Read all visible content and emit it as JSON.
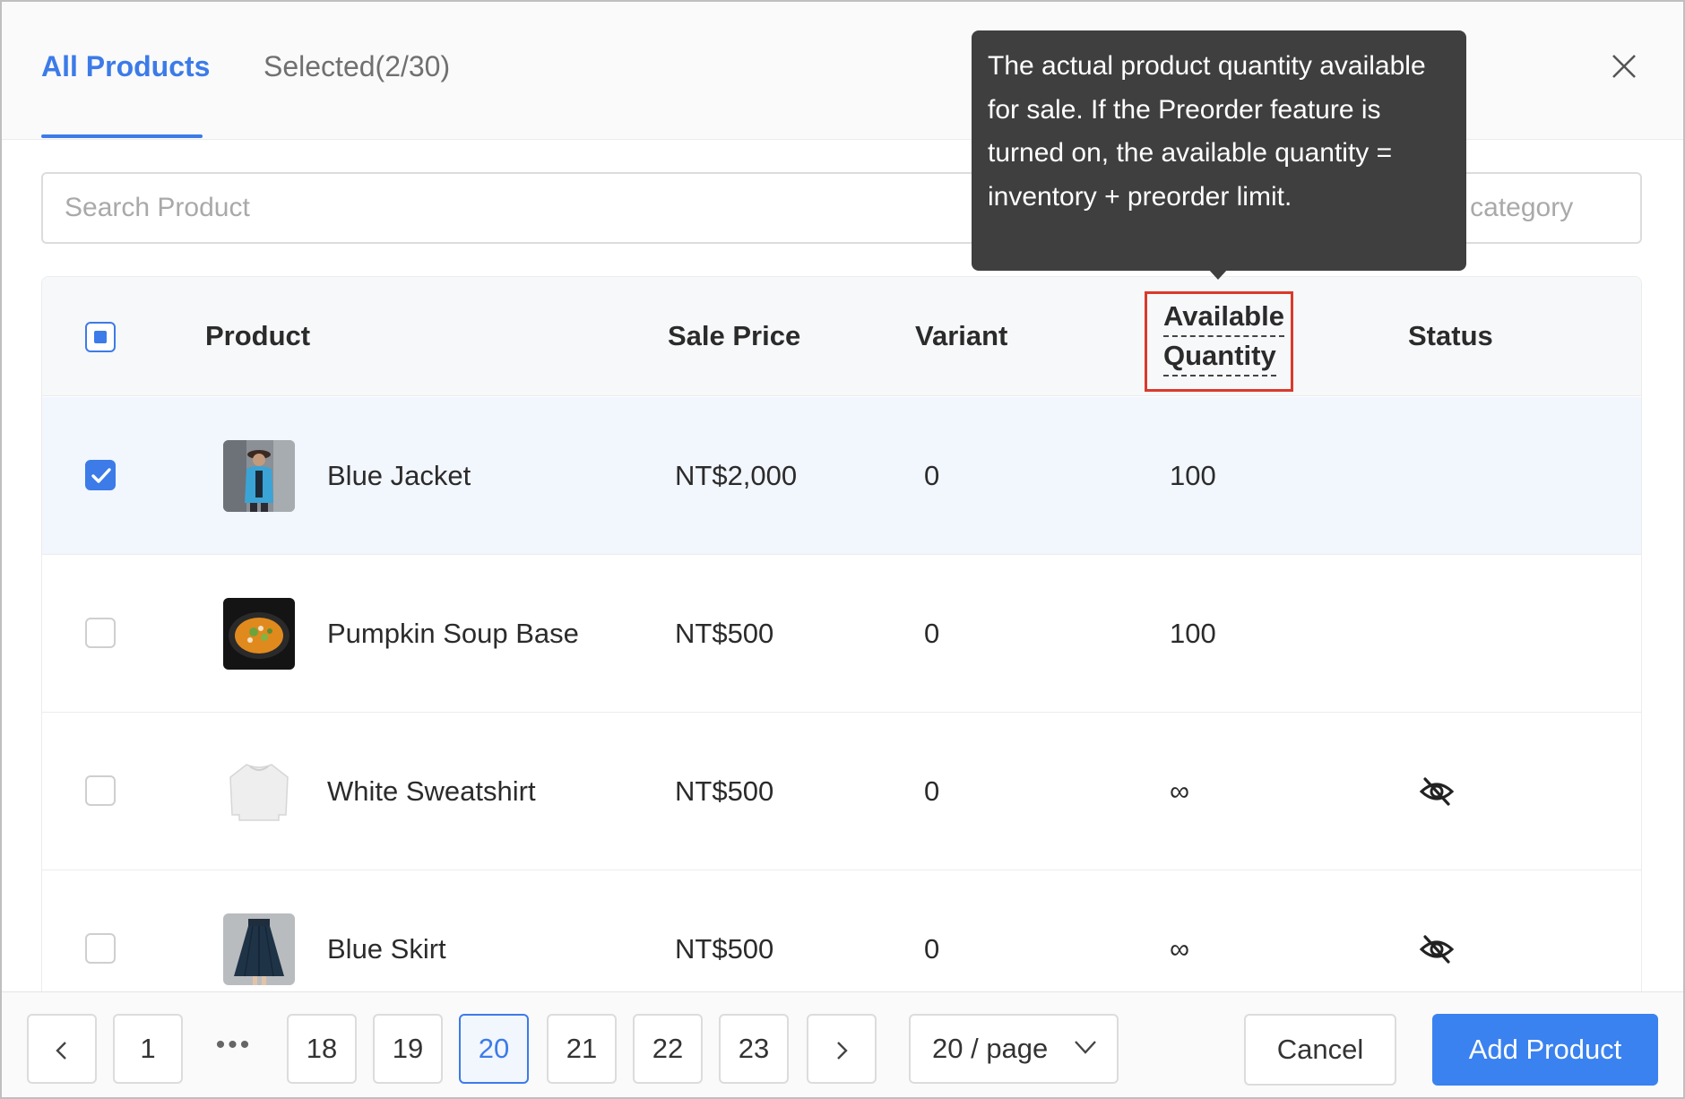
{
  "tabs": {
    "all_label": "All Products",
    "selected_label": "Selected(2/30)"
  },
  "search": {
    "placeholder": "Search Product",
    "category_placeholder": "Choose product category"
  },
  "table": {
    "headers": {
      "product": "Product",
      "sale_price": "Sale Price",
      "variant": "Variant",
      "available_line1": "Available",
      "available_line2": "Quantity",
      "status": "Status"
    },
    "rows": [
      {
        "name": "Blue Jacket",
        "price": "NT$2,000",
        "variant": "0",
        "available": "100",
        "selected": true,
        "status_icon": ""
      },
      {
        "name": "Pumpkin Soup Base",
        "price": "NT$500",
        "variant": "0",
        "available": "100",
        "selected": false,
        "status_icon": ""
      },
      {
        "name": "White Sweatshirt",
        "price": "NT$500",
        "variant": "0",
        "available": "∞",
        "selected": false,
        "status_icon": "eye-hidden-icon"
      },
      {
        "name": "Blue Skirt",
        "price": "NT$500",
        "variant": "0",
        "available": "∞",
        "selected": false,
        "status_icon": "eye-hidden-icon"
      }
    ]
  },
  "tooltip": {
    "text": "The actual product quantity available for sale. If the Preorder feature is turned on, the available quantity = inventory + preorder limit."
  },
  "pagination": {
    "pages": [
      "1",
      "18",
      "19",
      "20",
      "21",
      "22",
      "23"
    ],
    "current": "20",
    "ellipsis": "•••",
    "page_size": "20 / page"
  },
  "buttons": {
    "cancel": "Cancel",
    "add": "Add Product"
  },
  "colors": {
    "accent": "#3c7be8",
    "highlight_border": "#d93a2b",
    "tooltip_bg": "#3f3f3f"
  }
}
